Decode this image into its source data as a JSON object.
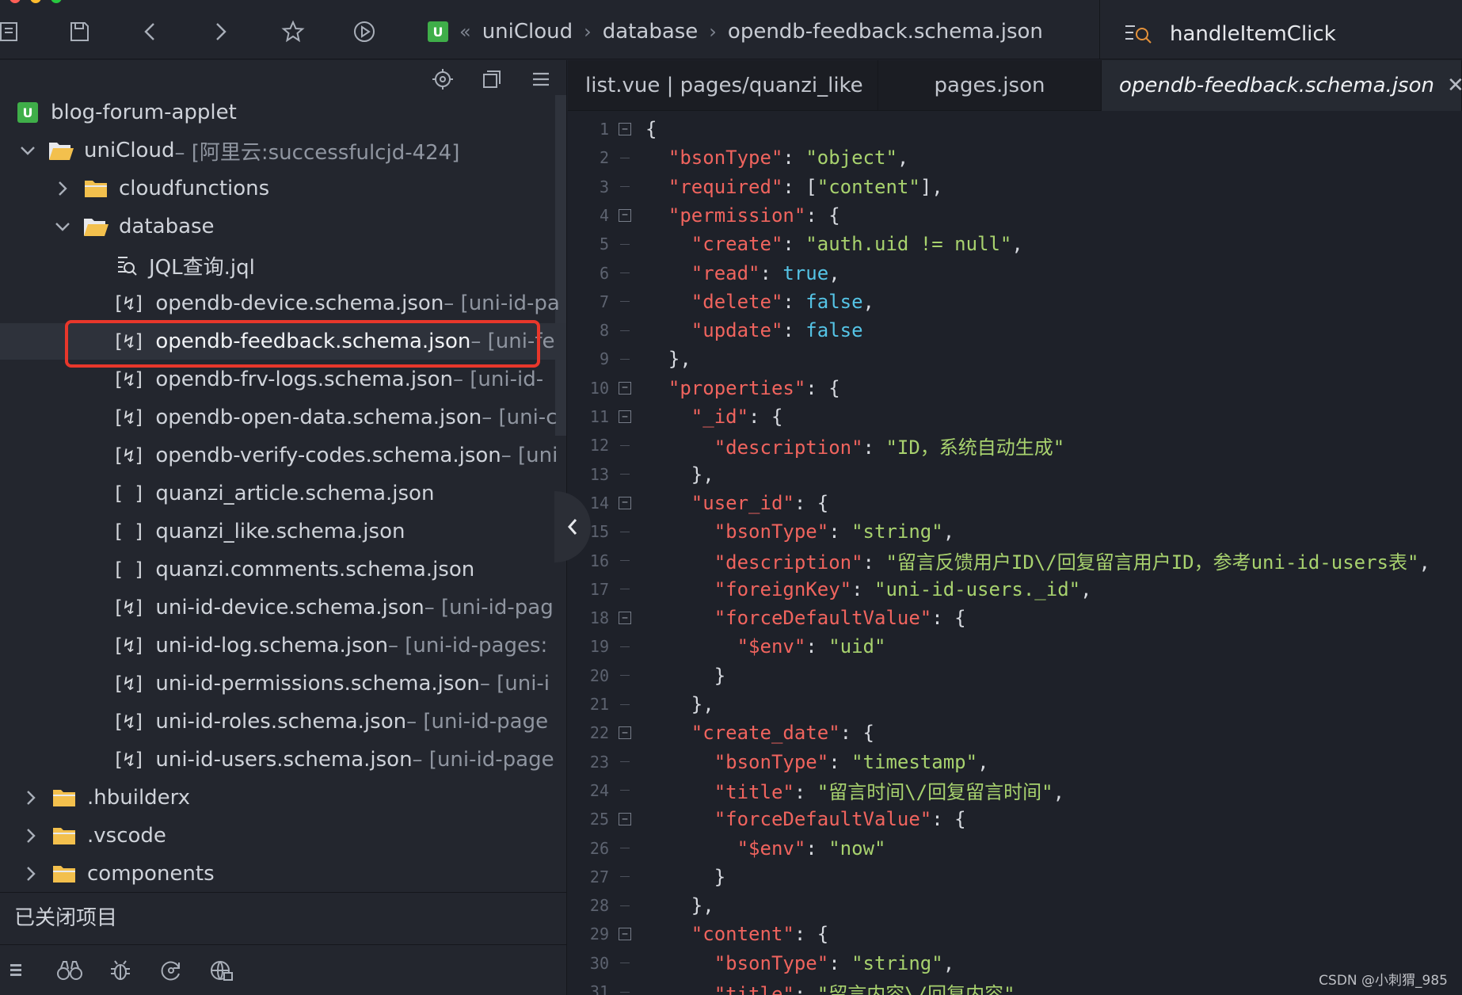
{
  "toolbar": {
    "breadcrumbs": [
      "uniCloud",
      "database",
      "opendb-feedback.schema.json"
    ],
    "search_text": "handleItemClick"
  },
  "sidebar": {
    "project": "blog-forum-applet",
    "unicloud_label": "uniCloud",
    "unicloud_suffix": " – [阿里云:successfulcjd-424]",
    "folders": {
      "cloudfunctions": "cloudfunctions",
      "database": "database"
    },
    "files": [
      {
        "name": "JQL查询.jql",
        "suffix": ""
      },
      {
        "name": "opendb-device.schema.json",
        "suffix": " – [uni-id-pa"
      },
      {
        "name": "opendb-feedback.schema.json",
        "suffix": " – [uni-fe"
      },
      {
        "name": "opendb-frv-logs.schema.json",
        "suffix": " – [uni-id-"
      },
      {
        "name": "opendb-open-data.schema.json",
        "suffix": " – [uni-c"
      },
      {
        "name": "opendb-verify-codes.schema.json",
        "suffix": " – [uni"
      },
      {
        "name": "quanzi_article.schema.json",
        "suffix": ""
      },
      {
        "name": "quanzi_like.schema.json",
        "suffix": ""
      },
      {
        "name": "quanzi.comments.schema.json",
        "suffix": ""
      },
      {
        "name": "uni-id-device.schema.json",
        "suffix": " – [uni-id-pag"
      },
      {
        "name": "uni-id-log.schema.json",
        "suffix": " – [uni-id-pages:"
      },
      {
        "name": "uni-id-permissions.schema.json",
        "suffix": " – [uni-i"
      },
      {
        "name": "uni-id-roles.schema.json",
        "suffix": " – [uni-id-page"
      },
      {
        "name": "uni-id-users.schema.json",
        "suffix": " – [uni-id-page"
      }
    ],
    "root_folders": [
      ".hbuilderx",
      ".vscode",
      "components"
    ],
    "closed_projects": "已关闭项目"
  },
  "tabs": [
    {
      "label": "list.vue | pages/quanzi_like"
    },
    {
      "label": "pages.json"
    },
    {
      "label": "opendb-feedback.schema.json"
    }
  ],
  "code_lines": [
    "{",
    "  \"bsonType\": \"object\",",
    "  \"required\": [\"content\"],",
    "  \"permission\": {",
    "    \"create\": \"auth.uid != null\",",
    "    \"read\": true,",
    "    \"delete\": false,",
    "    \"update\": false",
    "  },",
    "  \"properties\": {",
    "    \"_id\": {",
    "      \"description\": \"ID，系统自动生成\"",
    "    },",
    "    \"user_id\": {",
    "      \"bsonType\": \"string\",",
    "      \"description\": \"留言反馈用户ID\\/回复留言用户ID，参考uni-id-users表\",",
    "      \"foreignKey\": \"uni-id-users._id\",",
    "      \"forceDefaultValue\": {",
    "        \"$env\": \"uid\"",
    "      }",
    "    },",
    "    \"create_date\": {",
    "      \"bsonType\": \"timestamp\",",
    "      \"title\": \"留言时间\\/回复留言时间\",",
    "      \"forceDefaultValue\": {",
    "        \"$env\": \"now\"",
    "      }",
    "    },",
    "    \"content\": {",
    "      \"bsonType\": \"string\",",
    "      \"title\": \"留言内容\\/回复内容\","
  ],
  "fold_lines": [
    1,
    4,
    10,
    11,
    14,
    18,
    22,
    25,
    29
  ],
  "watermark": "CSDN @小刺猬_985",
  "colors": {
    "key": "#f0645e",
    "string": "#a8d26e",
    "boolean": "#55c4e6",
    "highlight_border": "#e8372b",
    "project_badge": "#3fae49",
    "folder": "#f3c04d"
  }
}
